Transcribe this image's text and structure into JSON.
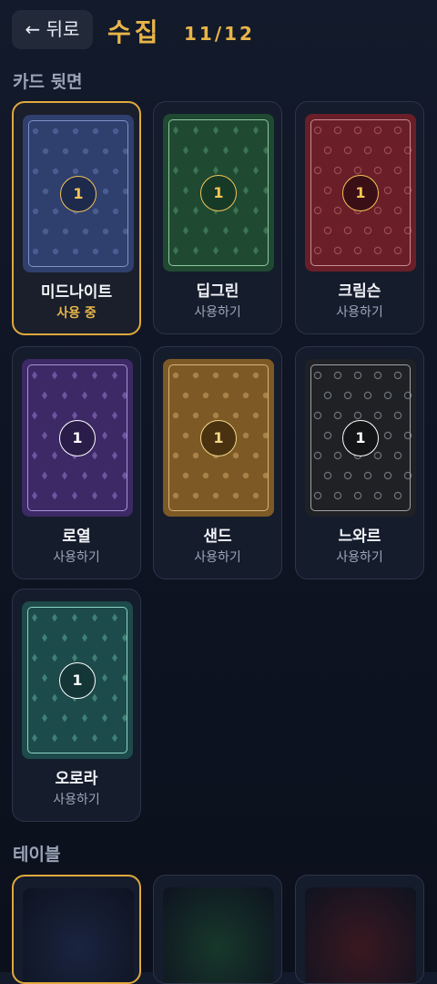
{
  "header": {
    "back_label": "← 뒤로",
    "title": "수집",
    "counter": "11/12"
  },
  "sections": {
    "card_backs": "카드 뒷면",
    "tables": "테이블"
  },
  "card_backs": [
    {
      "name": "미드나이트",
      "status": "사용 중",
      "badge": "1",
      "selected": true,
      "base": "#2f3f6e",
      "dot": "#4a5d91",
      "frame": "#7e93c6",
      "badge_fill": "#1d2a4c",
      "badge_color": "#f3c457",
      "pattern": "dot"
    },
    {
      "name": "딥그린",
      "status": "사용하기",
      "badge": "1",
      "selected": false,
      "base": "#1f4a31",
      "dot": "#3d7454",
      "frame": "#8fc7a2",
      "badge_fill": "#173a26",
      "badge_color": "#f3c457",
      "pattern": "diamond"
    },
    {
      "name": "크림슨",
      "status": "사용하기",
      "badge": "1",
      "selected": false,
      "base": "#6a1f28",
      "dot": "#9a4b55",
      "frame": "#c98c93",
      "badge_fill": "#3a0f15",
      "badge_color": "#f3c457",
      "pattern": "ring"
    },
    {
      "name": "로열",
      "status": "사용하기",
      "badge": "1",
      "selected": false,
      "base": "#3d2966",
      "dot": "#6d55a0",
      "frame": "#a894d6",
      "badge_fill": "#2b1d4a",
      "badge_color": "#ffffff",
      "pattern": "diamond"
    },
    {
      "name": "샌드",
      "status": "사용하기",
      "badge": "1",
      "selected": false,
      "base": "#7d5a25",
      "dot": "#a88248",
      "frame": "#d6b377",
      "badge_fill": "#4a3210",
      "badge_color": "#f3d98a",
      "pattern": "dot"
    },
    {
      "name": "느와르",
      "status": "사용하기",
      "badge": "1",
      "selected": false,
      "base": "#1f2124",
      "dot": "#6f7379",
      "frame": "#9ea2a7",
      "badge_fill": "#141517",
      "badge_color": "#ffffff",
      "pattern": "ring"
    },
    {
      "name": "오로라",
      "status": "사용하기",
      "badge": "1",
      "selected": false,
      "base": "#1d4a4a",
      "dot": "#3f8078",
      "frame": "#8ed4c6",
      "badge_fill": "#143636",
      "badge_color": "#ffffff",
      "pattern": "diamond"
    }
  ],
  "tables": [
    {
      "selected": true,
      "color": "#1a2440"
    },
    {
      "selected": false,
      "color": "#17382a"
    },
    {
      "selected": false,
      "color": "#3a1820"
    }
  ]
}
